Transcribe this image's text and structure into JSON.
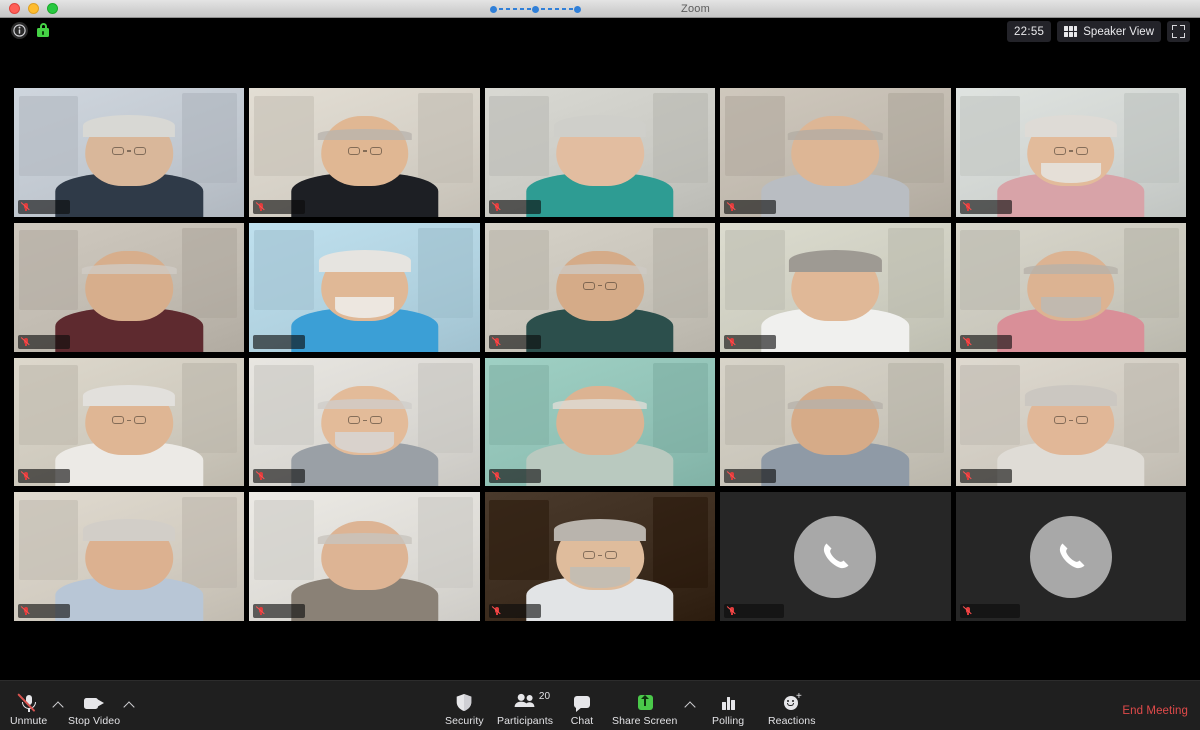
{
  "window": {
    "title": "Zoom",
    "traffic_lights": [
      "close-button",
      "minimize-button",
      "maximize-button"
    ],
    "connection_indicator": "connection-quality-dots"
  },
  "infobar": {
    "info_icon": "meeting-information-icon",
    "encryption_icon": "encryption-lock-icon",
    "timer": "22:55",
    "view_button": {
      "label": "Speaker View",
      "icon": "grid-view-icon"
    },
    "fullscreen_icon": "enter-fullscreen-icon"
  },
  "gallery": {
    "columns": 5,
    "rows": 4,
    "active_speaker_index": 6,
    "participants": [
      {
        "name": "",
        "type": "video",
        "muted": true,
        "wall": "#cfd6de",
        "skin": "#d9b79a",
        "hair": "#d8d8d4",
        "shirt": "#2f3a48",
        "glasses": true,
        "beard": false,
        "bald": false
      },
      {
        "name": "",
        "type": "video",
        "muted": true,
        "wall": "#e3ded4",
        "skin": "#e0b793",
        "hair": "#b9b4ae",
        "shirt": "#1d1f24",
        "glasses": true,
        "beard": false,
        "bald": true
      },
      {
        "name": "",
        "type": "video",
        "muted": true,
        "wall": "#d9d9d3",
        "skin": "#e2bda0",
        "hair": "#cfcfca",
        "shirt": "#2e9c93",
        "glasses": false,
        "beard": false,
        "bald": false
      },
      {
        "name": "",
        "type": "video",
        "muted": true,
        "wall": "#cfc8bd",
        "skin": "#ddb695",
        "hair": "#b3aca4",
        "shirt": "#b9bdc2",
        "glasses": false,
        "beard": false,
        "bald": true
      },
      {
        "name": "",
        "type": "video",
        "muted": true,
        "wall": "#dfe3e0",
        "skin": "#e2bb9b",
        "hair": "#dedbd6",
        "shirt": "#d8a3a8",
        "glasses": true,
        "beard": true,
        "bald": false
      },
      {
        "name": "",
        "type": "video",
        "muted": true,
        "wall": "#cfc9bf",
        "skin": "#d7ae8c",
        "hair": "#cfcac4",
        "shirt": "#5e2a2f",
        "glasses": false,
        "beard": false,
        "bald": true
      },
      {
        "name": "",
        "type": "video",
        "muted": false,
        "wall": "#bfe0ee",
        "skin": "#e0b896",
        "hair": "#e6e4e0",
        "shirt": "#3b9fd6",
        "glasses": false,
        "beard": true,
        "bald": false
      },
      {
        "name": "",
        "type": "video",
        "muted": true,
        "wall": "#d6d2c8",
        "skin": "#d5ab88",
        "hair": "#cdc9c3",
        "shirt": "#2c4f4c",
        "glasses": true,
        "beard": false,
        "bald": true
      },
      {
        "name": "",
        "type": "video",
        "muted": true,
        "wall": "#dcdccf",
        "skin": "#e0b897",
        "hair": "#9e9a93",
        "shirt": "#f0f0ee",
        "glasses": false,
        "beard": false,
        "bald": false
      },
      {
        "name": "",
        "type": "video",
        "muted": true,
        "wall": "#d8d6cb",
        "skin": "#dcb392",
        "hair": "#b6b1aa",
        "shirt": "#d98f98",
        "glasses": false,
        "beard": true,
        "bald": true
      },
      {
        "name": "",
        "type": "video",
        "muted": true,
        "wall": "#ddd8cc",
        "skin": "#dfb694",
        "hair": "#e2e0dc",
        "shirt": "#eceae6",
        "glasses": true,
        "beard": false,
        "bald": false
      },
      {
        "name": "",
        "type": "video",
        "muted": true,
        "wall": "#e8e6e1",
        "skin": "#e3bb99",
        "hair": "#cfcdc9",
        "shirt": "#9aa0a6",
        "glasses": true,
        "beard": true,
        "bald": true
      },
      {
        "name": "",
        "type": "video",
        "muted": true,
        "wall": "#9fd0c4",
        "skin": "#dcb392",
        "hair": "#dedcd6",
        "shirt": "#b9c9bf",
        "glasses": false,
        "beard": false,
        "bald": true
      },
      {
        "name": "",
        "type": "video",
        "muted": true,
        "wall": "#d8d4c9",
        "skin": "#d6ab88",
        "hair": "#b7b2aa",
        "shirt": "#8f9aa6",
        "glasses": false,
        "beard": false,
        "bald": true
      },
      {
        "name": "",
        "type": "video",
        "muted": true,
        "wall": "#ded9cf",
        "skin": "#e1b797",
        "hair": "#cbc7c1",
        "shirt": "#dfdcd6",
        "glasses": true,
        "beard": false,
        "bald": false
      },
      {
        "name": "",
        "type": "video",
        "muted": true,
        "wall": "#e0dacf",
        "skin": "#dcb190",
        "hair": "#d2cec8",
        "shirt": "#b8c6d6",
        "glasses": false,
        "beard": false,
        "bald": false
      },
      {
        "name": "",
        "type": "video",
        "muted": true,
        "wall": "#eceae5",
        "skin": "#ddb494",
        "hair": "#c8c4be",
        "shirt": "#8a8176",
        "glasses": false,
        "beard": false,
        "bald": true
      },
      {
        "name": "",
        "type": "video",
        "muted": true,
        "wall": "#4a3a2c",
        "skin": "#dfbc9c",
        "hair": "#b9b4ad",
        "shirt": "#e2e4e6",
        "glasses": true,
        "beard": true,
        "bald": false
      },
      {
        "name": "",
        "type": "phone",
        "muted": true,
        "avatar_icon": "phone-handset-icon"
      },
      {
        "name": "",
        "type": "phone",
        "muted": true,
        "avatar_icon": "phone-handset-icon"
      }
    ]
  },
  "toolbar": {
    "mute": {
      "label": "Unmute",
      "icon": "microphone-muted-icon",
      "caret": "audio-options-caret"
    },
    "video": {
      "label": "Stop Video",
      "icon": "camera-icon",
      "caret": "video-options-caret"
    },
    "security": {
      "label": "Security",
      "icon": "shield-icon"
    },
    "participants": {
      "label": "Participants",
      "icon": "people-icon",
      "count": "20"
    },
    "chat": {
      "label": "Chat",
      "icon": "chat-bubble-icon"
    },
    "share": {
      "label": "Share Screen",
      "icon": "share-screen-icon",
      "caret": "share-options-caret"
    },
    "polling": {
      "label": "Polling",
      "icon": "bar-chart-icon"
    },
    "reactions": {
      "label": "Reactions",
      "icon": "smiley-plus-icon"
    },
    "end": {
      "label": "End Meeting"
    }
  },
  "colors": {
    "accent_green": "#4ac94a",
    "end_red": "#e04a4a",
    "active_speaker": "#d6e64a",
    "toolbar_bg": "#1f1f1f",
    "stage_bg": "#000000"
  }
}
